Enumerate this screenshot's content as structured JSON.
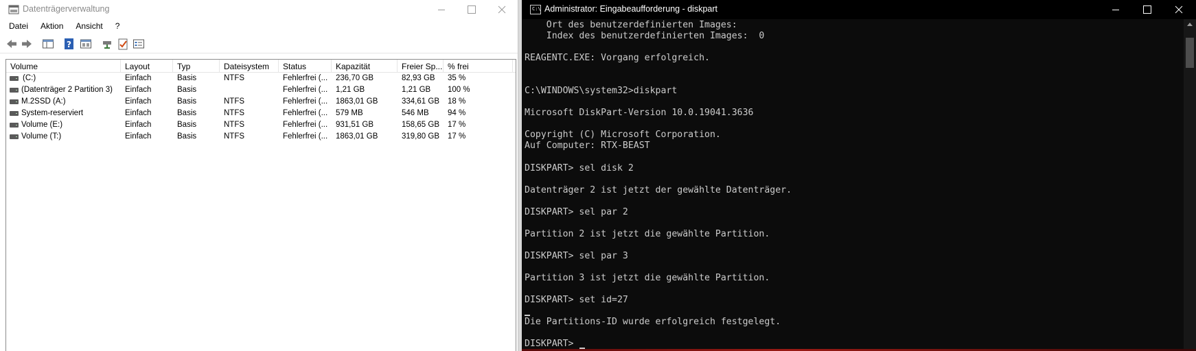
{
  "disk_management": {
    "title": "Datenträgerverwaltung",
    "menu": [
      "Datei",
      "Aktion",
      "Ansicht",
      "?"
    ],
    "toolbar_icons": [
      "back-icon",
      "forward-icon",
      "console-tree-icon",
      "help-icon",
      "properties-icon",
      "connect-disk-icon",
      "checklist-icon",
      "settings-list-icon"
    ],
    "columns": [
      "Volume",
      "Layout",
      "Typ",
      "Dateisystem",
      "Status",
      "Kapazität",
      "Freier Sp...",
      "% frei"
    ],
    "rows": [
      [
        "(C:)",
        "Einfach",
        "Basis",
        "NTFS",
        "Fehlerfrei (...",
        "236,70 GB",
        "82,93 GB",
        "35 %"
      ],
      [
        "(Datenträger 2 Partition 3)",
        "Einfach",
        "Basis",
        "",
        "Fehlerfrei (...",
        "1,21 GB",
        "1,21 GB",
        "100 %"
      ],
      [
        "M.2SSD (A:)",
        "Einfach",
        "Basis",
        "NTFS",
        "Fehlerfrei (...",
        "1863,01 GB",
        "334,61 GB",
        "18 %"
      ],
      [
        "System-reserviert",
        "Einfach",
        "Basis",
        "NTFS",
        "Fehlerfrei (...",
        "579 MB",
        "546 MB",
        "94 %"
      ],
      [
        "Volume (E:)",
        "Einfach",
        "Basis",
        "NTFS",
        "Fehlerfrei (...",
        "931,51 GB",
        "158,65 GB",
        "17 %"
      ],
      [
        "Volume (T:)",
        "Einfach",
        "Basis",
        "NTFS",
        "Fehlerfrei (...",
        "1863,01 GB",
        "319,80 GB",
        "17 %"
      ]
    ]
  },
  "cmd": {
    "title": "Administrator: Eingabeaufforderung - diskpart",
    "icon_label": "C:\\",
    "lines": [
      "    Ort des benutzerdefinierten Images:",
      "    Index des benutzerdefinierten Images:  0",
      "",
      "REAGENTC.EXE: Vorgang erfolgreich.",
      "",
      "",
      "C:\\WINDOWS\\system32>diskpart",
      "",
      "Microsoft DiskPart-Version 10.0.19041.3636",
      "",
      "Copyright (C) Microsoft Corporation.",
      "Auf Computer: RTX-BEAST",
      "",
      "DISKPART> sel disk 2",
      "",
      "Datenträger 2 ist jetzt der gewählte Datenträger.",
      "",
      "DISKPART> sel par 2",
      "",
      "Partition 2 ist jetzt die gewählte Partition.",
      "",
      "DISKPART> sel par 3",
      "",
      "Partition 3 ist jetzt die gewählte Partition.",
      "",
      "DISKPART> set id=27",
      "",
      "Die Partitions-ID wurde erfolgreich festgelegt.",
      "",
      "DISKPART> "
    ]
  }
}
